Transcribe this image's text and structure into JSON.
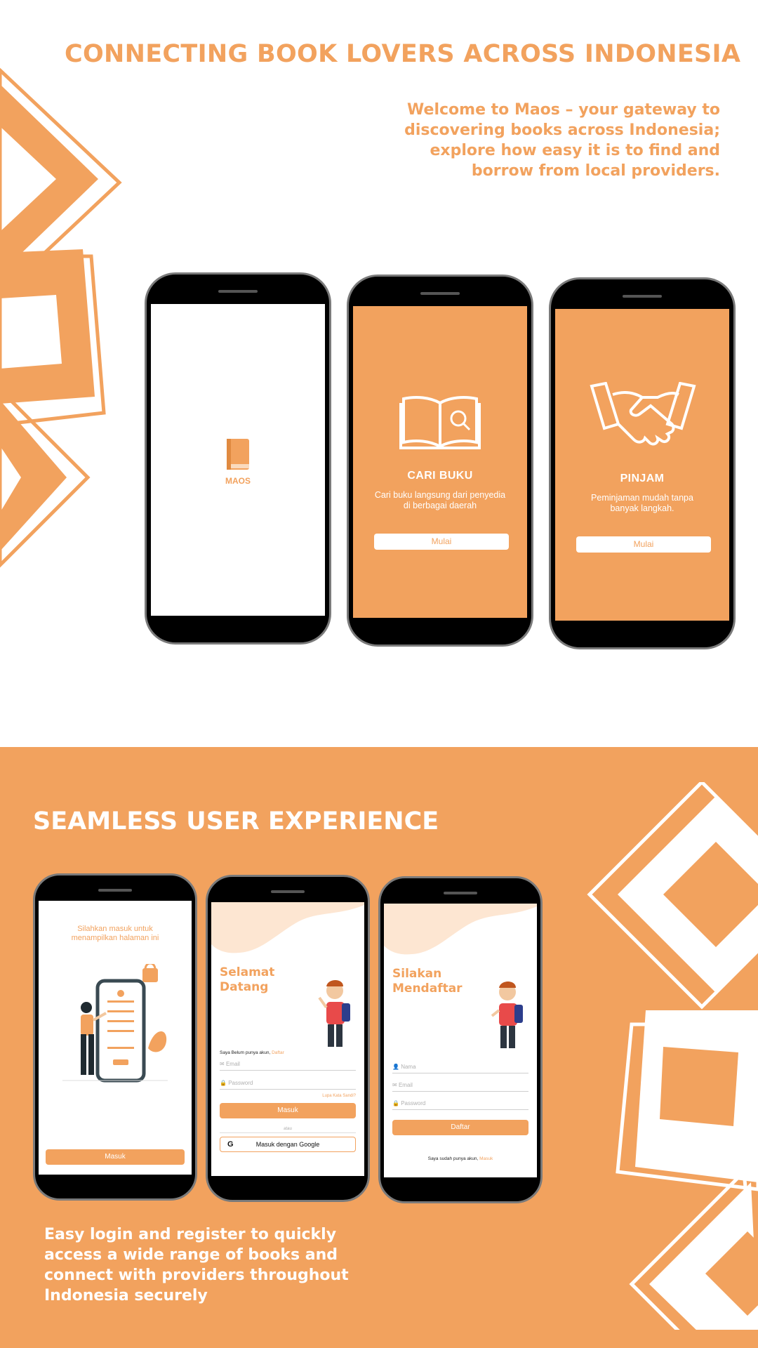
{
  "top": {
    "headline": "CONNECTING BOOK LOVERS ACROSS INDONESIA",
    "lead": [
      "Welcome to Maos – your gateway to",
      "discovering books across Indonesia;",
      "explore how easy it is to find and",
      "borrow from local providers."
    ]
  },
  "phones": {
    "splash": {
      "logo_text": "MAOS"
    },
    "cari": {
      "title": "CARI BUKU",
      "desc": [
        "Cari buku langsung dari penyedia",
        "di berbagai daerah"
      ],
      "button": "Mulai"
    },
    "pinjam": {
      "title": "PINJAM",
      "desc": [
        "Peminjaman mudah tanpa",
        "banyak langkah."
      ],
      "button": "Mulai"
    }
  },
  "bottom": {
    "headline": "SEAMLESS USER EXPERIENCE",
    "lead": [
      "Easy login and register to quickly",
      "access a wide range of books and",
      "connect with providers throughout",
      "Indonesia securely"
    ]
  },
  "login_prompt": {
    "message": [
      "Silahkan masuk untuk",
      "menampilkan halaman ini"
    ],
    "button": "Masuk"
  },
  "login": {
    "hero": [
      "Selamat",
      "Datang"
    ],
    "no_account": "Saya Belum punya akun,",
    "register_link": "Daftar",
    "email_placeholder": "Email",
    "password_placeholder": "Password",
    "forgot": "Lupa Kata Sandi?",
    "submit": "Masuk",
    "or": "atau",
    "google": "Masuk dengan Google"
  },
  "register": {
    "hero": [
      "Silakan",
      "Mendaftar"
    ],
    "name_placeholder": "Nama",
    "email_placeholder": "Email",
    "password_placeholder": "Password",
    "submit": "Daftar",
    "have_account": "Saya sudah punya akun,",
    "login_link": "Masuk"
  },
  "colors": {
    "accent": "#F2A25E",
    "dark": "#000000",
    "white": "#FFFFFF"
  }
}
